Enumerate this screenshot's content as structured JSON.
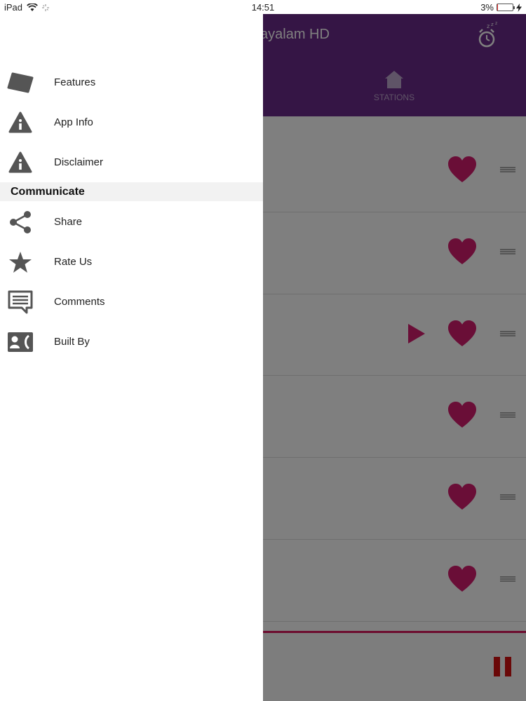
{
  "status_bar": {
    "device": "iPad",
    "time": "14:51",
    "battery": "3%",
    "battery_level": 0.03
  },
  "app": {
    "title": "ayalam HD",
    "tab_label": "STATIONS",
    "accent_color": "#6b2a8a",
    "heart_color": "#d41c6e",
    "rows": 6,
    "playing_row_index": 2
  },
  "drawer": {
    "items_top": [
      {
        "label": "Features",
        "icon": "tag-icon"
      },
      {
        "label": "App Info",
        "icon": "info-icon"
      },
      {
        "label": "Disclaimer",
        "icon": "info-icon"
      }
    ],
    "section_title": "Communicate",
    "items_bottom": [
      {
        "label": "Share",
        "icon": "share-icon"
      },
      {
        "label": "Rate Us",
        "icon": "star-icon"
      },
      {
        "label": "Comments",
        "icon": "comment-icon"
      },
      {
        "label": "Built By",
        "icon": "contact-icon"
      }
    ]
  }
}
